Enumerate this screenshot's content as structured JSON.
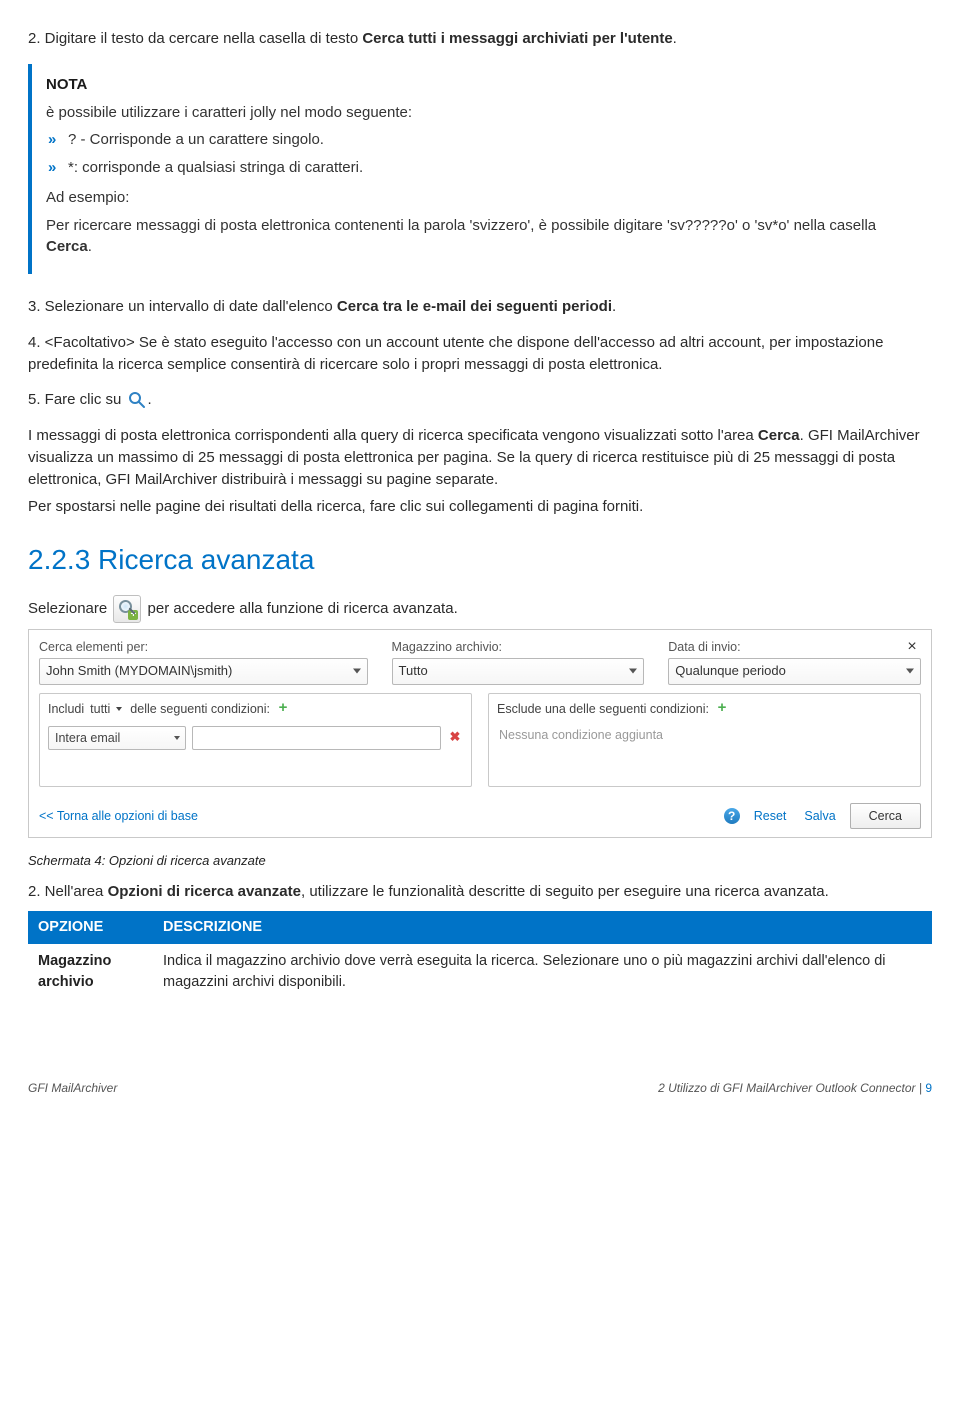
{
  "step2_pre": "2. Digitare il testo da cercare nella casella di testo ",
  "step2_bold": "Cerca tutti i messaggi archiviati per l'utente",
  "step2_post": ".",
  "note": {
    "title": "NOTA",
    "intro": "è possibile utilizzare i caratteri jolly nel modo seguente:",
    "items": [
      "? - Corrisponde a un carattere singolo.",
      "*: corrisponde a qualsiasi stringa di caratteri."
    ],
    "example_label": "Ad esempio:",
    "example_body_pre": "Per ricercare messaggi di posta elettronica contenenti la parola 'svizzero', è possibile digitare 'sv?????o' o 'sv*o' nella casella ",
    "example_body_bold": "Cerca",
    "example_body_post": "."
  },
  "step3_pre": "3. Selezionare un intervallo di date dall'elenco ",
  "step3_bold": "Cerca tra le e-mail dei seguenti periodi",
  "step3_post": ".",
  "step4": "4. <Facoltativo> Se è stato eseguito l'accesso con un account utente che dispone dell'accesso ad altri account, per impostazione predefinita la ricerca semplice consentirà di ricercare solo i propri messaggi di posta elettronica.",
  "step5_pre": "5. Fare clic su ",
  "step5_post": ".",
  "result_p1_pre": "I messaggi di posta elettronica corrispondenti alla query di ricerca specificata vengono visualizzati sotto l'area ",
  "result_p1_bold": "Cerca",
  "result_p1_post": ". GFI MailArchiver visualizza un massimo di 25 messaggi di posta elettronica per pagina. Se la query di ricerca restituisce più di 25 messaggi di posta elettronica, GFI MailArchiver distribuirà i messaggi su pagine separate.",
  "result_p2": "Per spostarsi nelle pagine dei risultati della ricerca, fare clic sui collegamenti di pagina forniti.",
  "section_title": "2.2.3 Ricerca avanzata",
  "adv_intro_pre": "Selezionare ",
  "adv_intro_post": " per accedere alla funzione di ricerca avanzata.",
  "panel": {
    "col1_label": "Cerca elementi per:",
    "col1_value": "John Smith (MYDOMAIN\\jsmith)",
    "col2_label": "Magazzino archivio:",
    "col2_value": "Tutto",
    "col3_label": "Data di invio:",
    "col3_value": "Qualunque periodo",
    "include_pre": "Includi",
    "include_sel": "tutti",
    "include_post": "delle seguenti condizioni:",
    "include_field": "Intera email",
    "exclude_text": "Esclude una delle seguenti condizioni:",
    "exclude_placeholder": "Nessuna condizione aggiunta",
    "back_link": "<< Torna alle opzioni di base",
    "reset": "Reset",
    "save": "Salva",
    "search": "Cerca"
  },
  "caption": "Schermata 4: Opzioni di ricerca avanzate",
  "step2b_pre": "2. Nell'area ",
  "step2b_bold": "Opzioni di ricerca avanzate",
  "step2b_post": ", utilizzare le funzionalità descritte di seguito per eseguire una ricerca avanzata.",
  "table": {
    "h1": "OPZIONE",
    "h2": "DESCRIZIONE",
    "r1_opt": "Magazzino archivio",
    "r1_desc": "Indica il magazzino archivio dove verrà eseguita la ricerca. Selezionare uno o più magazzini archivi dall'elenco di magazzini archivi disponibili."
  },
  "footer": {
    "left": "GFI MailArchiver",
    "right_text": "2 Utilizzo di GFI MailArchiver Outlook Connector",
    "page_sep": " | ",
    "page_num": "9"
  }
}
